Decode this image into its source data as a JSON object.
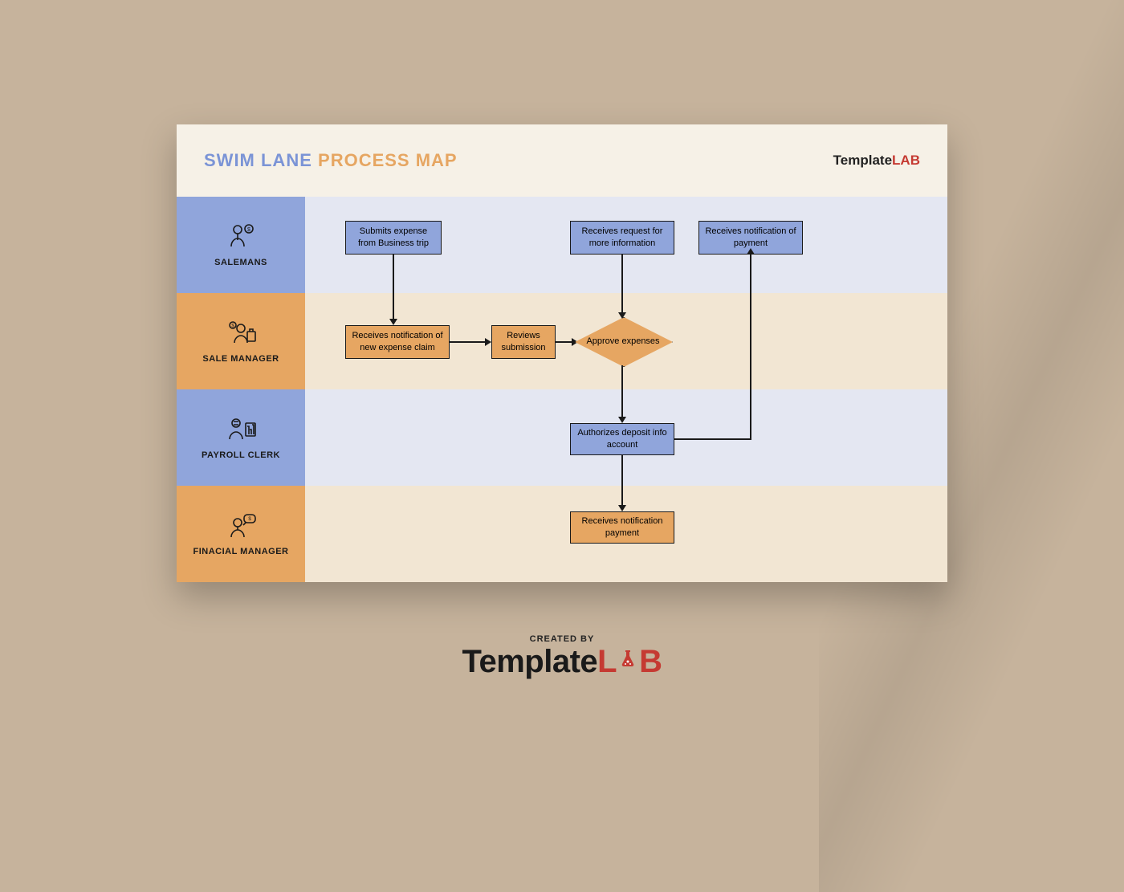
{
  "title": {
    "part1": "SWIM LANE",
    "part2": "PROCESS MAP"
  },
  "brand": {
    "template": "Template",
    "lab": "LAB"
  },
  "lanes": [
    {
      "label": "SALEMANS"
    },
    {
      "label": "SALE MANAGER"
    },
    {
      "label": "PAYROLL CLERK"
    },
    {
      "label": "FINACIAL MANAGER"
    }
  ],
  "nodes": {
    "submit": "Submits expense from Business trip",
    "recvInfo": "Receives request for more information",
    "recvPay": "Receives notification of payment",
    "recvClaim": "Receives notification of new expense claim",
    "review": "Reviews submission",
    "approve": "Approve expenses",
    "authorize": "Authorizes deposit info account",
    "finRecv": "Receives notification payment"
  },
  "credit": {
    "createdBy": "CREATED BY",
    "template": "Template",
    "lab": "L",
    "ab": "B"
  }
}
